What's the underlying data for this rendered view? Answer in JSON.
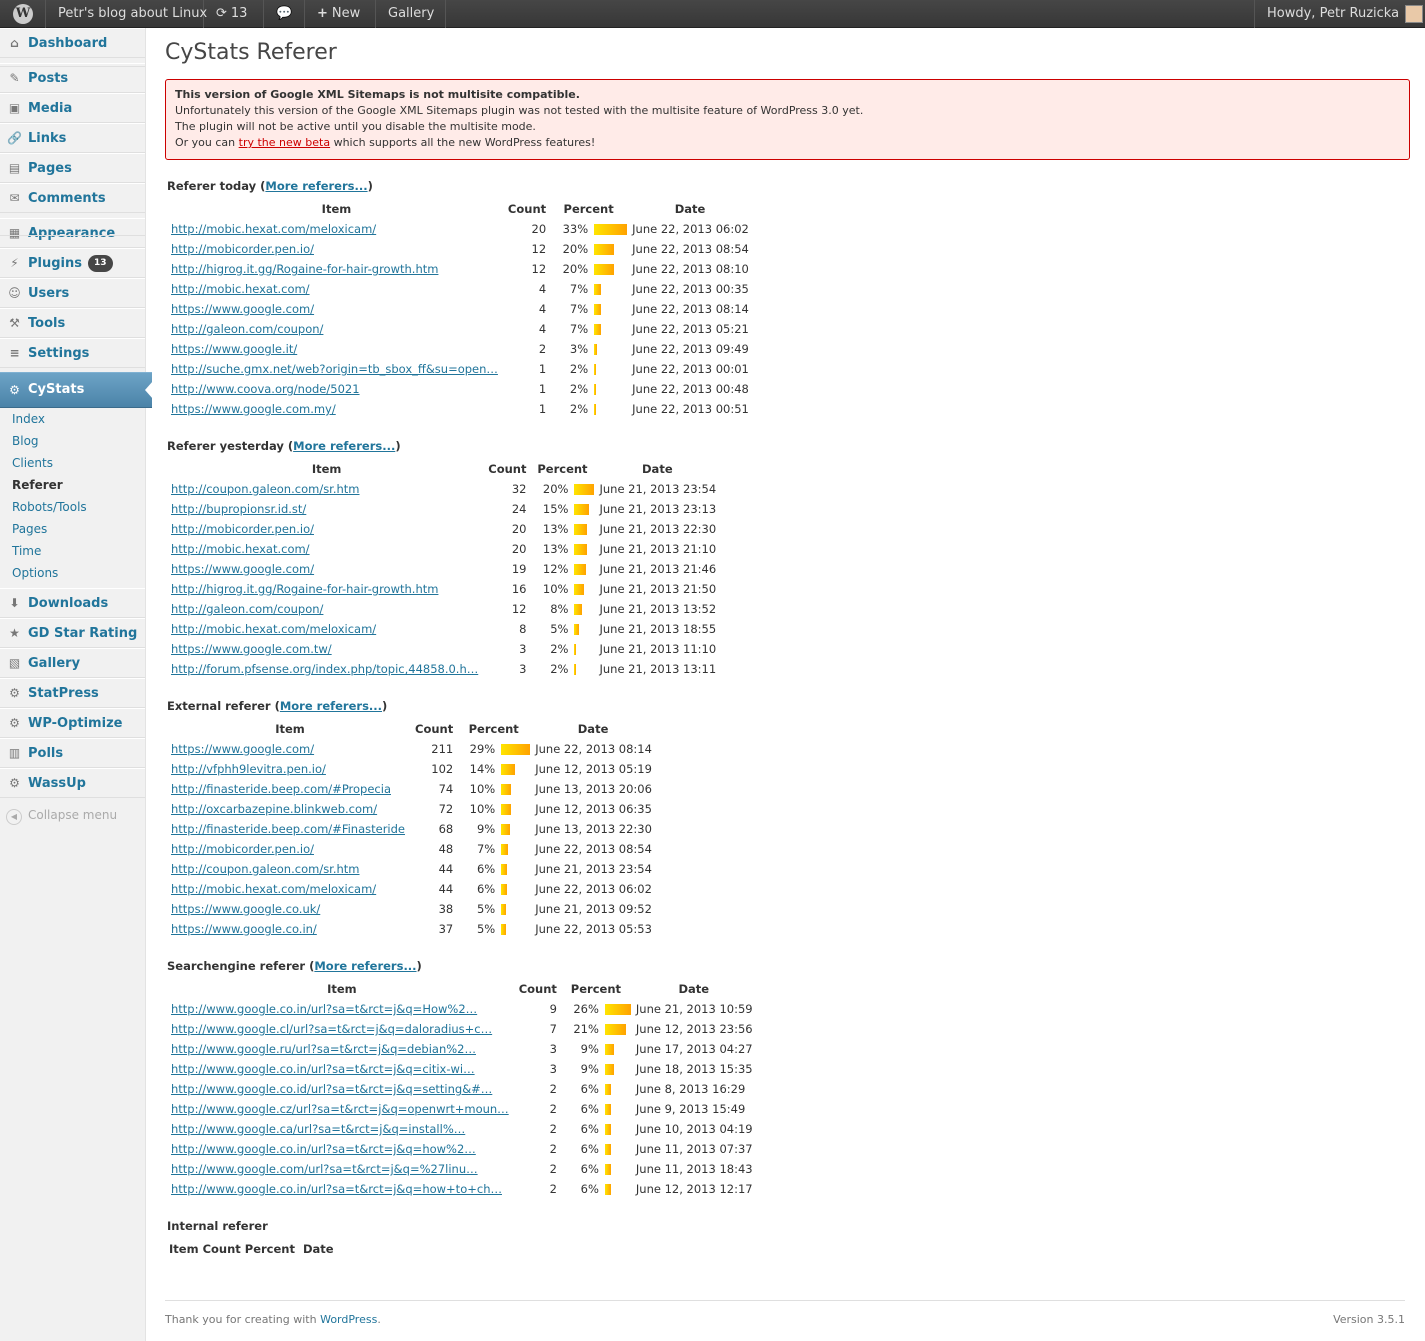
{
  "adminbar": {
    "site_name": "Petr's blog about Linux",
    "updates_count": "13",
    "new_label": "New",
    "gallery_label": "Gallery",
    "howdy": "Howdy, Petr Ruzicka"
  },
  "sidebar": {
    "items": [
      {
        "label": "Dashboard",
        "icon": "dashboard-icon"
      },
      {
        "label": "Posts",
        "icon": "pushpin-icon"
      },
      {
        "label": "Media",
        "icon": "media-icon"
      },
      {
        "label": "Links",
        "icon": "link-icon"
      },
      {
        "label": "Pages",
        "icon": "page-icon"
      },
      {
        "label": "Comments",
        "icon": "comment-icon"
      },
      {
        "label": "Appearance",
        "icon": "appearance-icon"
      },
      {
        "label": "Plugins",
        "icon": "plugin-icon",
        "badge": "13"
      },
      {
        "label": "Users",
        "icon": "users-icon"
      },
      {
        "label": "Tools",
        "icon": "tools-icon"
      },
      {
        "label": "Settings",
        "icon": "settings-icon"
      },
      {
        "label": "CyStats",
        "icon": "gear-icon"
      },
      {
        "label": "Downloads",
        "icon": "download-icon"
      },
      {
        "label": "GD Star Rating",
        "icon": "star-icon"
      },
      {
        "label": "Gallery",
        "icon": "gallery-icon"
      },
      {
        "label": "StatPress",
        "icon": "gear-icon"
      },
      {
        "label": "WP-Optimize",
        "icon": "gear-icon"
      },
      {
        "label": "Polls",
        "icon": "poll-icon"
      },
      {
        "label": "WassUp",
        "icon": "gear-icon"
      }
    ],
    "submenu": [
      "Index",
      "Blog",
      "Clients",
      "Referer",
      "Robots/Tools",
      "Pages",
      "Time",
      "Options"
    ],
    "active_submenu": "Referer",
    "collapse_label": "Collapse menu"
  },
  "page": {
    "title": "CyStats Referer"
  },
  "notice": {
    "heading": "This version of Google XML Sitemaps is not multisite compatible.",
    "line1": "Unfortunately this version of the Google XML Sitemaps plugin was not tested with the multisite feature of WordPress 3.0 yet.",
    "line2": "The plugin will not be active until you disable the multisite mode.",
    "line3_pre": "Or you can ",
    "line3_link": "try the new beta",
    "line3_post": " which supports all the new WordPress features!"
  },
  "columns": {
    "item": "Item",
    "count": "Count",
    "percent": "Percent",
    "date": "Date"
  },
  "more_label": "More referers...",
  "sections": [
    {
      "title": "Referer today",
      "rows": [
        {
          "item": "http://mobic.hexat.com/meloxicam/",
          "count": "20",
          "percent": "33%",
          "pct": 33,
          "date": "June 22, 2013 06:02"
        },
        {
          "item": "http://mobicorder.pen.io/",
          "count": "12",
          "percent": "20%",
          "pct": 20,
          "date": "June 22, 2013 08:54"
        },
        {
          "item": "http://higrog.it.gg/Rogaine-for-hair-growth.htm",
          "count": "12",
          "percent": "20%",
          "pct": 20,
          "date": "June 22, 2013 08:10"
        },
        {
          "item": "http://mobic.hexat.com/",
          "count": "4",
          "percent": "7%",
          "pct": 7,
          "date": "June 22, 2013 00:35"
        },
        {
          "item": "https://www.google.com/",
          "count": "4",
          "percent": "7%",
          "pct": 7,
          "date": "June 22, 2013 08:14"
        },
        {
          "item": "http://galeon.com/coupon/",
          "count": "4",
          "percent": "7%",
          "pct": 7,
          "date": "June 22, 2013 05:21"
        },
        {
          "item": "https://www.google.it/",
          "count": "2",
          "percent": "3%",
          "pct": 3,
          "date": "June 22, 2013 09:49"
        },
        {
          "item": "http://suche.gmx.net/web?origin=tb_sbox_ff&su=open…",
          "count": "1",
          "percent": "2%",
          "pct": 2,
          "date": "June 22, 2013 00:01"
        },
        {
          "item": "http://www.coova.org/node/5021",
          "count": "1",
          "percent": "2%",
          "pct": 2,
          "date": "June 22, 2013 00:48"
        },
        {
          "item": "https://www.google.com.my/",
          "count": "1",
          "percent": "2%",
          "pct": 2,
          "date": "June 22, 2013 00:51"
        }
      ]
    },
    {
      "title": "Referer yesterday",
      "rows": [
        {
          "item": "http://coupon.galeon.com/sr.htm",
          "count": "32",
          "percent": "20%",
          "pct": 20,
          "date": "June 21, 2013 23:54"
        },
        {
          "item": "http://bupropionsr.id.st/",
          "count": "24",
          "percent": "15%",
          "pct": 15,
          "date": "June 21, 2013 23:13"
        },
        {
          "item": "http://mobicorder.pen.io/",
          "count": "20",
          "percent": "13%",
          "pct": 13,
          "date": "June 21, 2013 22:30"
        },
        {
          "item": "http://mobic.hexat.com/",
          "count": "20",
          "percent": "13%",
          "pct": 13,
          "date": "June 21, 2013 21:10"
        },
        {
          "item": "https://www.google.com/",
          "count": "19",
          "percent": "12%",
          "pct": 12,
          "date": "June 21, 2013 21:46"
        },
        {
          "item": "http://higrog.it.gg/Rogaine-for-hair-growth.htm",
          "count": "16",
          "percent": "10%",
          "pct": 10,
          "date": "June 21, 2013 21:50"
        },
        {
          "item": "http://galeon.com/coupon/",
          "count": "12",
          "percent": "8%",
          "pct": 8,
          "date": "June 21, 2013 13:52"
        },
        {
          "item": "http://mobic.hexat.com/meloxicam/",
          "count": "8",
          "percent": "5%",
          "pct": 5,
          "date": "June 21, 2013 18:55"
        },
        {
          "item": "https://www.google.com.tw/",
          "count": "3",
          "percent": "2%",
          "pct": 2,
          "date": "June 21, 2013 11:10"
        },
        {
          "item": "http://forum.pfsense.org/index.php/topic,44858.0.h…",
          "count": "3",
          "percent": "2%",
          "pct": 2,
          "date": "June 21, 2013 13:11"
        }
      ]
    },
    {
      "title": "External referer",
      "rows": [
        {
          "item": "https://www.google.com/",
          "count": "211",
          "percent": "29%",
          "pct": 29,
          "date": "June 22, 2013 08:14"
        },
        {
          "item": "http://vfphh9levitra.pen.io/",
          "count": "102",
          "percent": "14%",
          "pct": 14,
          "date": "June 12, 2013 05:19"
        },
        {
          "item": "http://finasteride.beep.com/#Propecia",
          "count": "74",
          "percent": "10%",
          "pct": 10,
          "date": "June 13, 2013 20:06"
        },
        {
          "item": "http://oxcarbazepine.blinkweb.com/",
          "count": "72",
          "percent": "10%",
          "pct": 10,
          "date": "June 12, 2013 06:35"
        },
        {
          "item": "http://finasteride.beep.com/#Finasteride",
          "count": "68",
          "percent": "9%",
          "pct": 9,
          "date": "June 13, 2013 22:30"
        },
        {
          "item": "http://mobicorder.pen.io/",
          "count": "48",
          "percent": "7%",
          "pct": 7,
          "date": "June 22, 2013 08:54"
        },
        {
          "item": "http://coupon.galeon.com/sr.htm",
          "count": "44",
          "percent": "6%",
          "pct": 6,
          "date": "June 21, 2013 23:54"
        },
        {
          "item": "http://mobic.hexat.com/meloxicam/",
          "count": "44",
          "percent": "6%",
          "pct": 6,
          "date": "June 22, 2013 06:02"
        },
        {
          "item": "https://www.google.co.uk/",
          "count": "38",
          "percent": "5%",
          "pct": 5,
          "date": "June 21, 2013 09:52"
        },
        {
          "item": "https://www.google.co.in/",
          "count": "37",
          "percent": "5%",
          "pct": 5,
          "date": "June 22, 2013 05:53"
        }
      ]
    },
    {
      "title": "Searchengine referer",
      "rows": [
        {
          "item": "http://www.google.co.in/url?sa=t&rct=j&q=How%2…",
          "count": "9",
          "percent": "26%",
          "pct": 26,
          "date": "June 21, 2013 10:59"
        },
        {
          "item": "http://www.google.cl/url?sa=t&rct=j&q=daloradius+c…",
          "count": "7",
          "percent": "21%",
          "pct": 21,
          "date": "June 12, 2013 23:56"
        },
        {
          "item": "http://www.google.ru/url?sa=t&rct=j&q=debian%2…",
          "count": "3",
          "percent": "9%",
          "pct": 9,
          "date": "June 17, 2013 04:27"
        },
        {
          "item": "http://www.google.co.in/url?sa=t&rct=j&q=citix-wi…",
          "count": "3",
          "percent": "9%",
          "pct": 9,
          "date": "June 18, 2013 15:35"
        },
        {
          "item": "http://www.google.co.id/url?sa=t&rct=j&q=setting&#…",
          "count": "2",
          "percent": "6%",
          "pct": 6,
          "date": "June 8, 2013 16:29"
        },
        {
          "item": "http://www.google.cz/url?sa=t&rct=j&q=openwrt+moun…",
          "count": "2",
          "percent": "6%",
          "pct": 6,
          "date": "June 9, 2013 15:49"
        },
        {
          "item": "http://www.google.ca/url?sa=t&rct=j&q=install%…",
          "count": "2",
          "percent": "6%",
          "pct": 6,
          "date": "June 10, 2013 04:19"
        },
        {
          "item": "http://www.google.co.in/url?sa=t&rct=j&q=how%2…",
          "count": "2",
          "percent": "6%",
          "pct": 6,
          "date": "June 11, 2013 07:37"
        },
        {
          "item": "http://www.google.com/url?sa=t&rct=j&q=%27linu…",
          "count": "2",
          "percent": "6%",
          "pct": 6,
          "date": "June 11, 2013 18:43"
        },
        {
          "item": "http://www.google.co.in/url?sa=t&rct=j&q=how+to+ch…",
          "count": "2",
          "percent": "6%",
          "pct": 6,
          "date": "June 12, 2013 12:17"
        }
      ]
    }
  ],
  "internal": {
    "title": "Internal referer"
  },
  "footer": {
    "thanks_pre": "Thank you for creating with ",
    "thanks_link": "WordPress",
    "thanks_post": ".",
    "version": "Version 3.5.1"
  }
}
